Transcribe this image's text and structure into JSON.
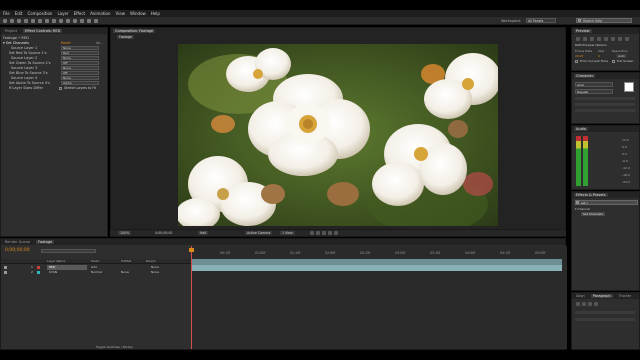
{
  "menu": [
    "File",
    "Edit",
    "Composition",
    "Layer",
    "Effect",
    "Animation",
    "View",
    "Window",
    "Help"
  ],
  "toolbar": {
    "workspace_label": "Workspace:",
    "workspace_value": "All Panels",
    "search_placeholder": "Search Help"
  },
  "effects_panel": {
    "tabs": [
      "Project",
      "Effect Controls: RED"
    ],
    "header": "Footage • RED",
    "effect_name": "Set Channels",
    "effect_reset": "Reset",
    "rows": [
      {
        "label": "Source Layer 1",
        "value": "None"
      },
      {
        "label": "Set Red To Source 1's",
        "value": "Red"
      },
      {
        "label": "Source Layer 2",
        "value": "None"
      },
      {
        "label": "Set Green To Source 2's",
        "value": "Off"
      },
      {
        "label": "Source Layer 3",
        "value": "None"
      },
      {
        "label": "Set Blue To Source 3's",
        "value": "Off"
      },
      {
        "label": "Source Layer 4",
        "value": "None"
      },
      {
        "label": "Set Alpha To Source 4's",
        "value": "Alpha"
      },
      {
        "label": "If Layer Sizes Differ",
        "value": "Stretch Layers to Fit"
      }
    ]
  },
  "viewer": {
    "tab": "Composition: Footage",
    "subtab": "Footage",
    "zoom": "100%",
    "timecode": "0;00;00;00",
    "resolution": "Half",
    "camera": "Active Camera",
    "views": "1 View"
  },
  "timeline": {
    "tabs": [
      "Render Queue",
      "Footage"
    ],
    "timecode": "0;00;00;00",
    "columns": {
      "layer_name": "Layer Name",
      "mode": "Mode",
      "trkmat": "TrkMat",
      "parent": "Parent"
    },
    "layers": [
      {
        "num": "1",
        "name": "RED",
        "mode": "Add",
        "parent": "None"
      },
      {
        "num": "2",
        "name": "CYAN",
        "mode": "Normal",
        "trkmat": "None",
        "parent": "None"
      }
    ],
    "ticks": [
      "00:15f",
      "01:00f",
      "01:15f",
      "02:00f",
      "02:15f",
      "03:00f",
      "03:15f",
      "04:00f",
      "04:15f",
      "05:00f"
    ],
    "footer": "Toggle Switches / Modes"
  },
  "right_panel": {
    "preview_tab": "Preview",
    "preview_title": "RAM Preview Options",
    "frame_rate": "Frame Rate",
    "skip": "Skip",
    "resolution": "Resolution",
    "frame_rate_val": "29.97",
    "skip_val": "0",
    "resolution_val": "Auto",
    "from_current": "From Current Time",
    "full_screen": "Full Screen",
    "character_tab": "Character",
    "font": "Arial",
    "font_style": "Regular",
    "audio_tab": "Audio",
    "audio_levels": [
      "12.0",
      "6.0",
      "0.0",
      "-6.0",
      "-12.0",
      "-18.0",
      "-24.0"
    ],
    "effects_tab": "Effects & Presets",
    "effects_search": "set c",
    "effects_category": "Channel",
    "effects_result": "Set Channels",
    "align_tab": "Align",
    "paragraph_tab": "Paragraph",
    "tracker_tab": "Tracker"
  },
  "colors": {
    "accent": "#d98a1a",
    "panel": "#2e2e2e",
    "layer_red": "#c84040",
    "layer_cyan": "#2fb8b8",
    "bar": "#7fa8ad"
  }
}
